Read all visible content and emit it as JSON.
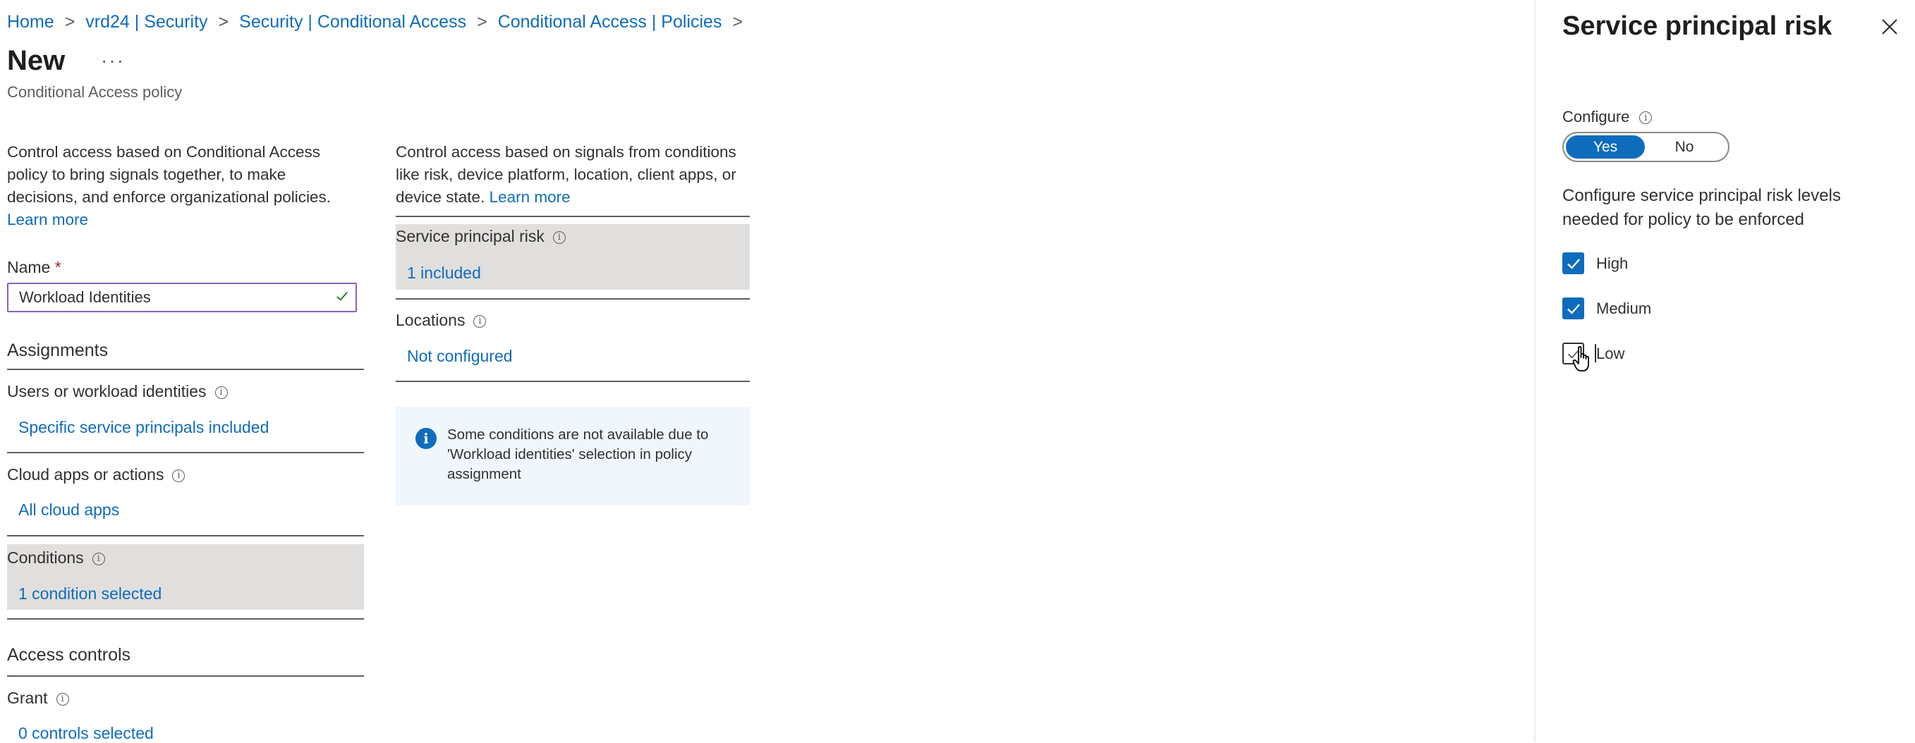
{
  "breadcrumb": [
    "Home",
    "vrd24 | Security",
    "Security | Conditional Access",
    "Conditional Access | Policies"
  ],
  "breadcrumb_separator": ">",
  "page": {
    "title": "New",
    "more_label": "···",
    "subtitle": "Conditional Access policy"
  },
  "left": {
    "description": "Control access based on Conditional Access policy to bring signals together, to make decisions, and enforce organizational policies.",
    "learn_more": "Learn more",
    "name_label": "Name",
    "required_mark": "*",
    "name_value": "Workload Identities",
    "assignments_heading": "Assignments",
    "users_label": "Users or workload identities",
    "users_value": "Specific service principals included",
    "cloud_label": "Cloud apps or actions",
    "cloud_value": "All cloud apps",
    "conditions_label": "Conditions",
    "conditions_value": "1 condition selected",
    "access_heading": "Access controls",
    "grant_label": "Grant",
    "grant_value": "0 controls selected"
  },
  "middle": {
    "description": "Control access based on signals from conditions like risk, device platform, location, client apps, or device state.",
    "learn_more": "Learn more",
    "spr_label": "Service principal risk",
    "spr_value": "1 included",
    "locations_label": "Locations",
    "locations_value": "Not configured",
    "notice": "Some conditions are not available due to 'Workload identities' selection in policy assignment"
  },
  "panel": {
    "title": "Service principal risk",
    "configure_label": "Configure",
    "toggle_yes": "Yes",
    "toggle_no": "No",
    "toggle_selected": "Yes",
    "description": "Configure service principal risk levels needed for policy to be enforced",
    "levels": [
      {
        "label": "High",
        "checked": true
      },
      {
        "label": "Medium",
        "checked": true
      },
      {
        "label": "Low",
        "checked": false
      }
    ]
  },
  "colors": {
    "link": "#0f6cbd",
    "selected_row": "#e1dfdd",
    "notice_bg": "#eff6fc",
    "input_border": "#8764b8",
    "valid_check": "#107c10"
  },
  "icons": [
    "info-icon",
    "close-icon",
    "checkmark-icon",
    "hand-pointer-cursor-icon",
    "ellipsis-icon"
  ]
}
